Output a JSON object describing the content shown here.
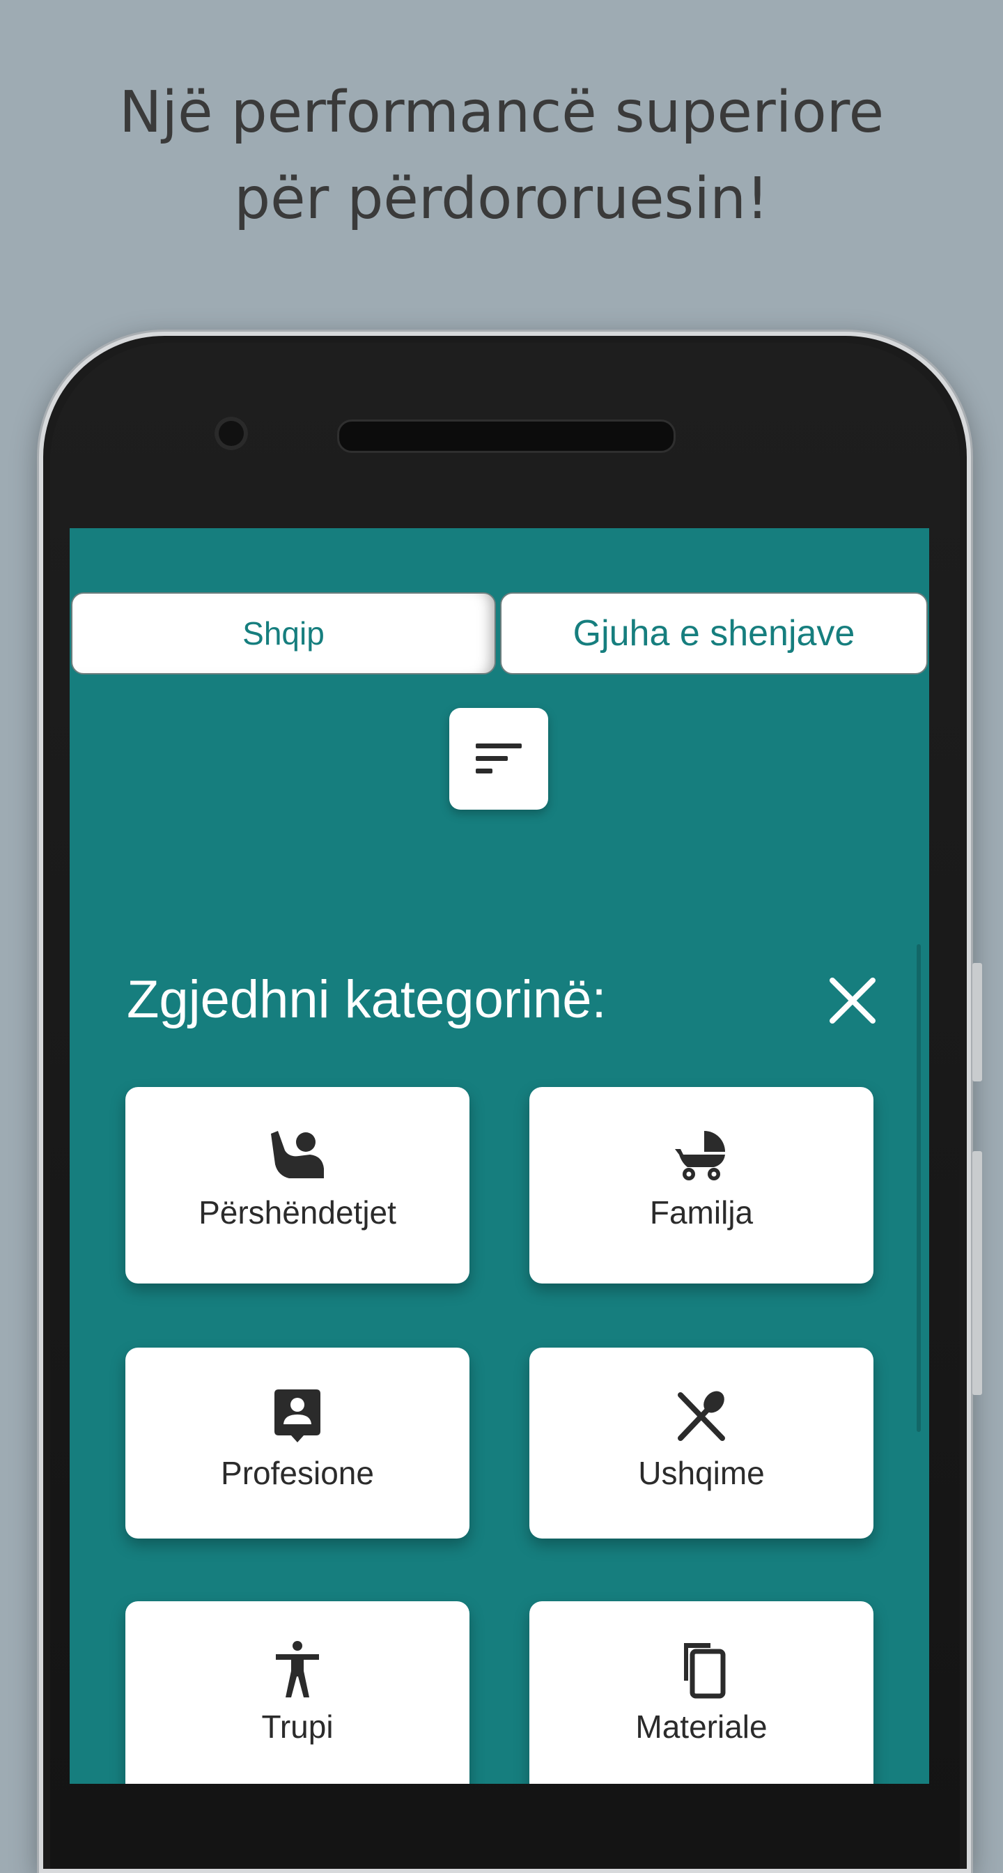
{
  "headline": {
    "line1": "Një performancë superiore",
    "line2": "për përdororuesin!"
  },
  "tabs": [
    {
      "label": "Shqip"
    },
    {
      "label": "Gjuha e shenjave"
    }
  ],
  "filter": {
    "icon": "sort-icon"
  },
  "category_panel": {
    "title": "Zgjedhni kategorinë:",
    "close_icon": "close-icon"
  },
  "categories": [
    {
      "label": "Përshëndetjet",
      "icon": "waving-person-icon"
    },
    {
      "label": "Familja",
      "icon": "stroller-icon"
    },
    {
      "label": "Profesione",
      "icon": "contact-badge-icon"
    },
    {
      "label": "Ushqime",
      "icon": "fork-spoon-icon"
    },
    {
      "label": "Trupi",
      "icon": "accessibility-icon"
    },
    {
      "label": "Materiale",
      "icon": "copy-icon"
    }
  ],
  "colors": {
    "background": "#9eabb3",
    "screen": "#167e7e",
    "accent_text": "#167e7e"
  }
}
